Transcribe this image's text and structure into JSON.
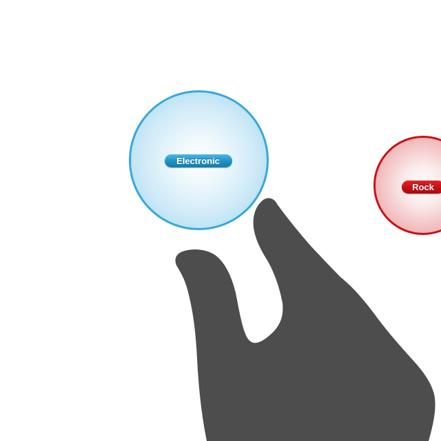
{
  "bubbles": [
    {
      "label": "Electronic",
      "color": "#33a9dd"
    },
    {
      "label": "Rock",
      "color": "#cc1115"
    }
  ],
  "overlay": {
    "icon": "hand-pointer-icon",
    "color": "#4d4d4d"
  }
}
